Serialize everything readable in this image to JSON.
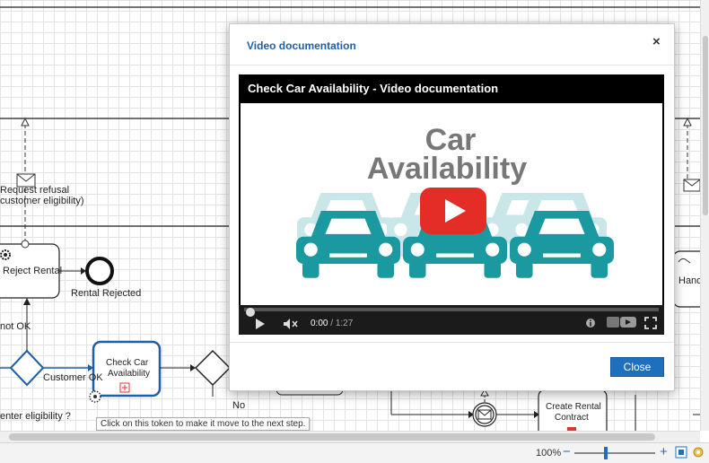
{
  "diagram": {
    "labels": {
      "request_refusal": "Request refusal",
      "customer_eligibility": "customer eligibility)",
      "reject_rental": "Reject Rental",
      "rental_rejected": "Rental Rejected",
      "not_ok": "not OK",
      "customer_ok": "Customer OK",
      "check_car_line1": "Check Car",
      "check_car_line2": "Availability",
      "no": "No",
      "create_rental_line1": "Create Rental",
      "create_rental_line2": "Contract",
      "enter_eligibility": "enter eligibility ?",
      "hand": "Hand"
    },
    "tooltip": "Click on this token to make it move to the next step.",
    "colors": {
      "active_task": "#1f5fa8",
      "grid": "#e3e3e3"
    }
  },
  "modal": {
    "title": "Video documentation",
    "close_icon": "×",
    "video": {
      "title": "Check Car Availability  - Video documentation",
      "thumbnail_line1": "Car",
      "thumbnail_line2": "Availability",
      "current_time": "0:00",
      "separator": "/",
      "duration": "1:27",
      "progress": 0.0,
      "colors": {
        "car": "#1a9aa0",
        "car_faded": "#c9e6e8",
        "title_text": "#777777",
        "play": "#e52d27"
      }
    },
    "close_label": "Close",
    "accent": "#1f6fbf"
  },
  "statusbar": {
    "zoom": "100%",
    "zoom_out": "−",
    "zoom_in": "+"
  }
}
